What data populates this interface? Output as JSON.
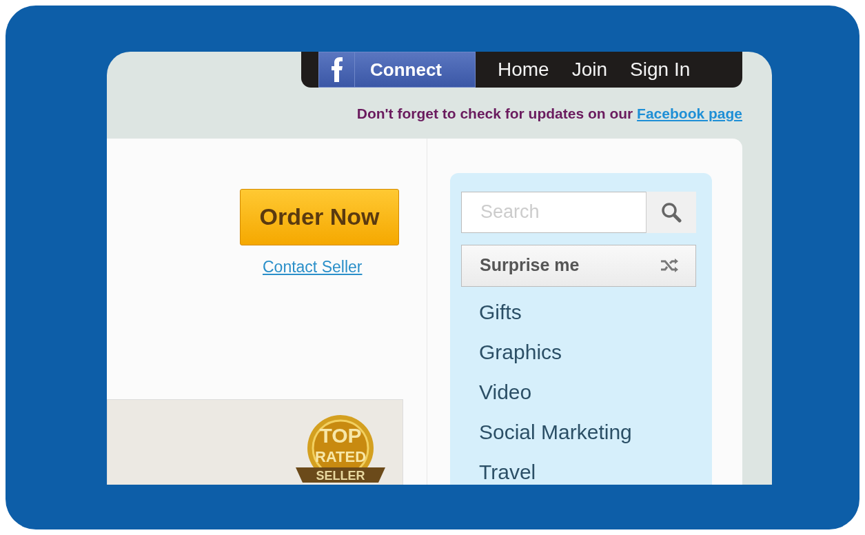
{
  "top_bar": {
    "facebook_button": "Connect",
    "links": [
      "Home",
      "Join",
      "Sign In"
    ]
  },
  "notice": {
    "text": "Don't forget to check for updates on our",
    "link": "Facebook page"
  },
  "order": {
    "button": "Order Now",
    "link": "Contact Seller"
  },
  "badge": {
    "line_1": "TOP",
    "line_2": "RATED",
    "line_3": "SELLER"
  },
  "sidebar": {
    "search": {
      "placeholder": "Search"
    },
    "surprise_button": "Surprise me",
    "categories": [
      "Gifts",
      "Graphics",
      "Video",
      "Social Marketing",
      "Travel"
    ]
  }
}
